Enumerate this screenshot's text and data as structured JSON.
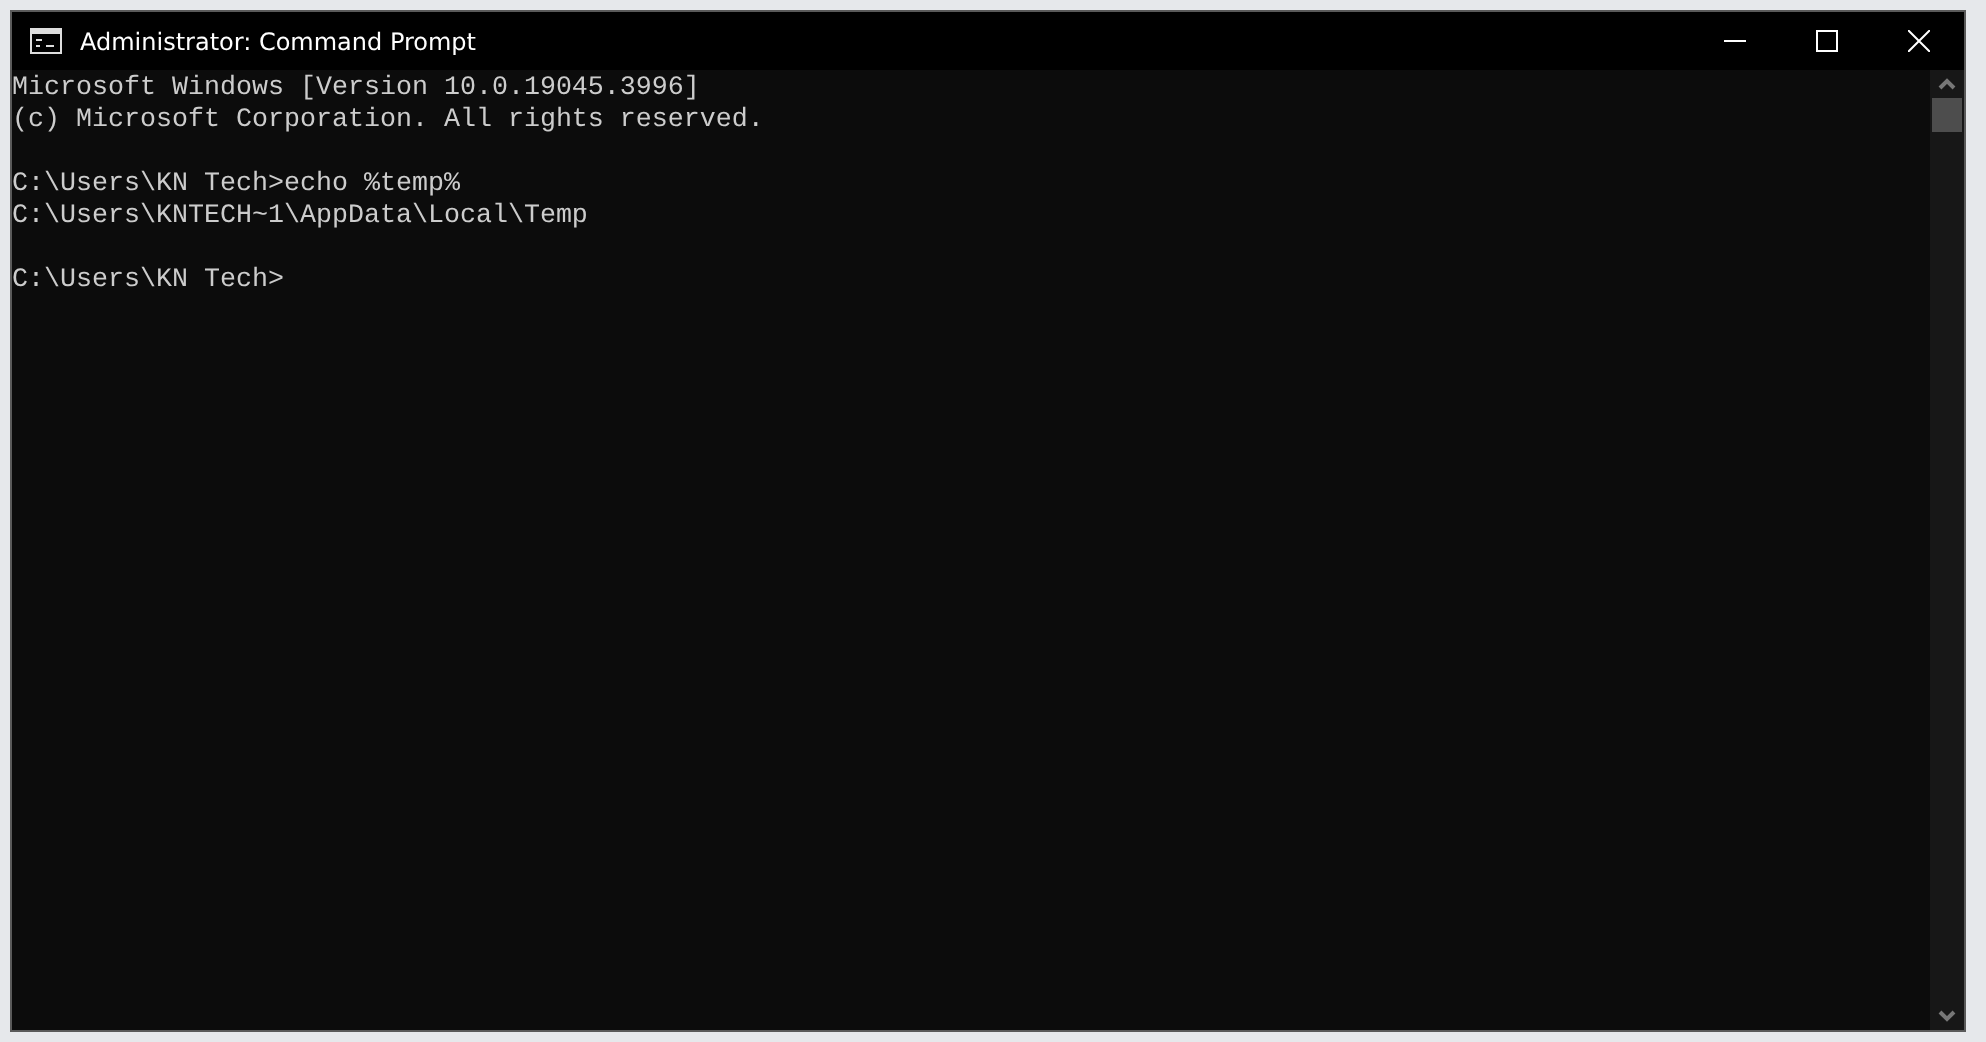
{
  "window": {
    "title": "Administrator: Command Prompt"
  },
  "console": {
    "blocks": [
      [
        "Microsoft Windows [Version 10.0.19045.3996]",
        "(c) Microsoft Corporation. All rights reserved."
      ],
      [
        "C:\\Users\\KN Tech>echo %temp%",
        "C:\\Users\\KNTECH~1\\AppData\\Local\\Temp"
      ],
      [
        "C:\\Users\\KN Tech>"
      ]
    ]
  }
}
